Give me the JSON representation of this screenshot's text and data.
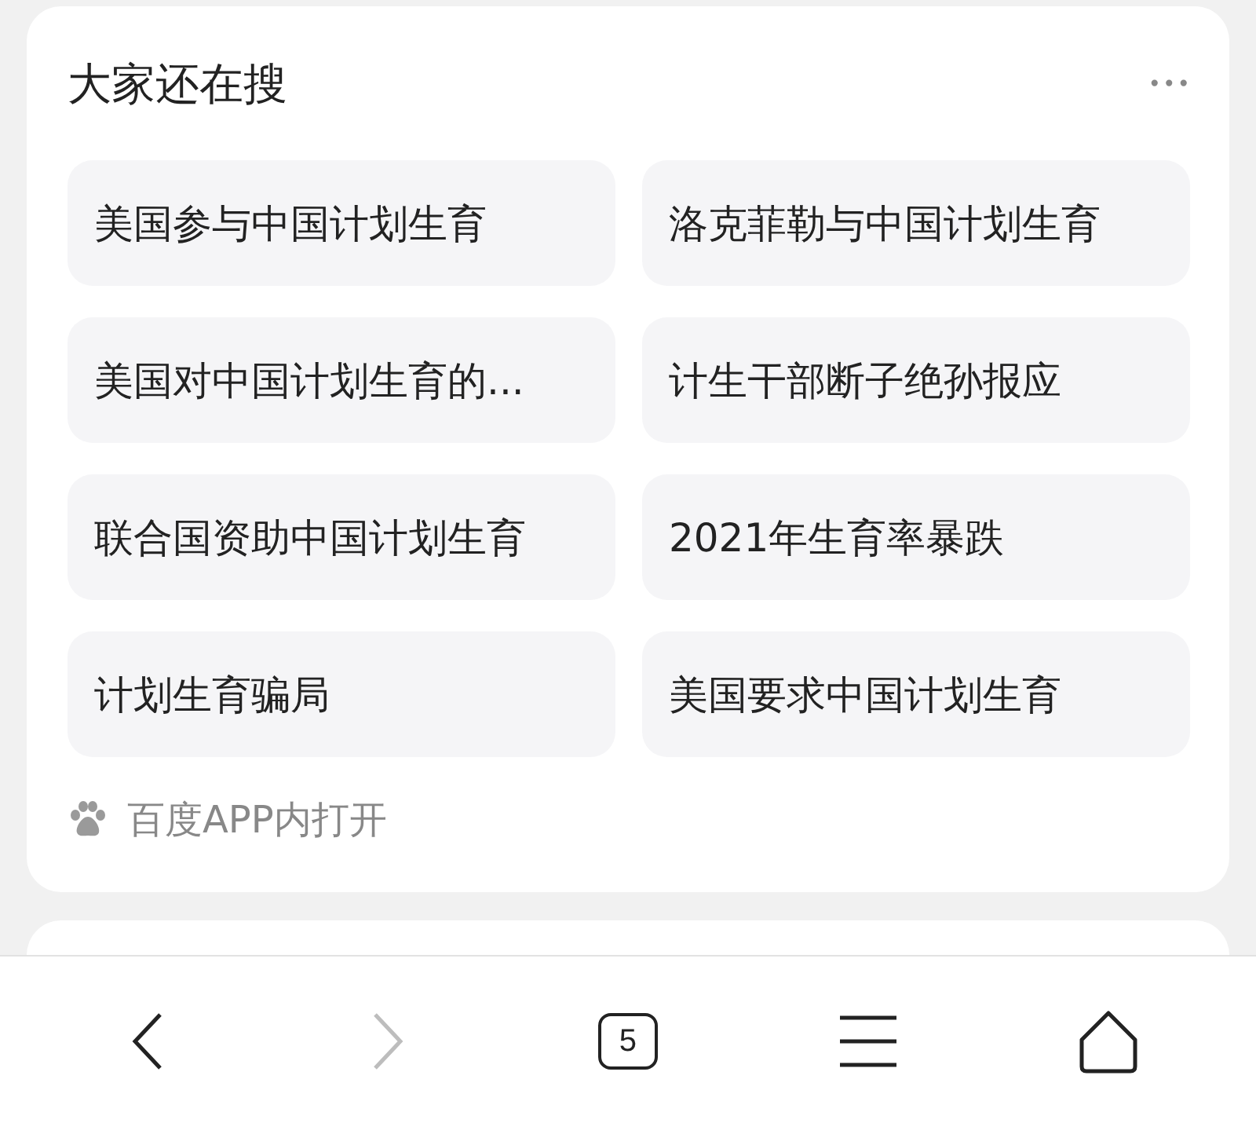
{
  "card": {
    "title": "大家还在搜",
    "more": "•••",
    "chips": [
      {
        "label": "美国参与中国计划生育"
      },
      {
        "label": "洛克菲勒与中国计划生育"
      },
      {
        "label": "美国对中国计划生育的..."
      },
      {
        "label": "计生干部断子绝孙报应"
      },
      {
        "label": "联合国资助中国计划生育"
      },
      {
        "label": "2021年生育率暴跌"
      },
      {
        "label": "计划生育骗局"
      },
      {
        "label": "美国要求中国计划生育"
      }
    ],
    "footer": "百度APP内打开"
  },
  "nav": [
    {
      "kind": "back",
      "disabled": false
    },
    {
      "kind": "forward",
      "disabled": true
    },
    {
      "kind": "tabs",
      "count": "5"
    },
    {
      "kind": "menu"
    },
    {
      "kind": "home"
    }
  ]
}
